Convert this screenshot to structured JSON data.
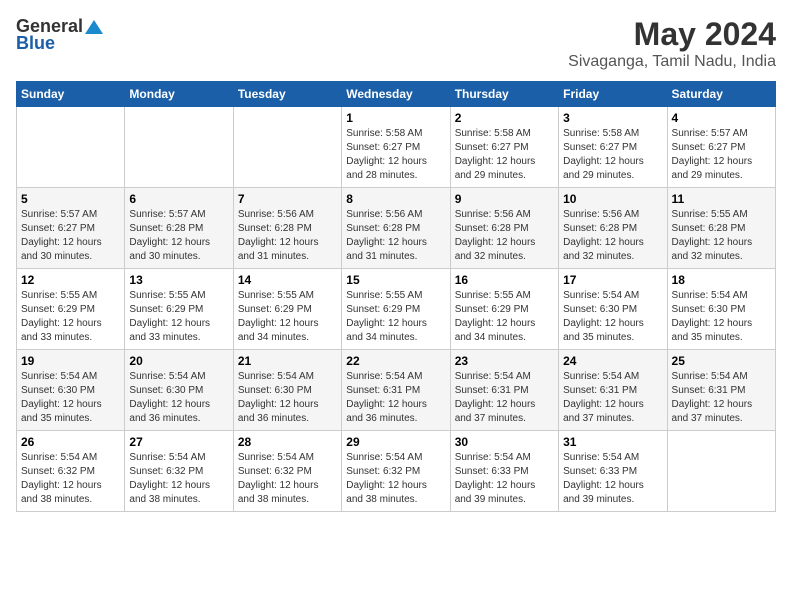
{
  "logo": {
    "general": "General",
    "blue": "Blue"
  },
  "title": {
    "month": "May 2024",
    "location": "Sivaganga, Tamil Nadu, India"
  },
  "headers": [
    "Sunday",
    "Monday",
    "Tuesday",
    "Wednesday",
    "Thursday",
    "Friday",
    "Saturday"
  ],
  "weeks": [
    [
      {
        "day": "",
        "info": ""
      },
      {
        "day": "",
        "info": ""
      },
      {
        "day": "",
        "info": ""
      },
      {
        "day": "1",
        "info": "Sunrise: 5:58 AM\nSunset: 6:27 PM\nDaylight: 12 hours\nand 28 minutes."
      },
      {
        "day": "2",
        "info": "Sunrise: 5:58 AM\nSunset: 6:27 PM\nDaylight: 12 hours\nand 29 minutes."
      },
      {
        "day": "3",
        "info": "Sunrise: 5:58 AM\nSunset: 6:27 PM\nDaylight: 12 hours\nand 29 minutes."
      },
      {
        "day": "4",
        "info": "Sunrise: 5:57 AM\nSunset: 6:27 PM\nDaylight: 12 hours\nand 29 minutes."
      }
    ],
    [
      {
        "day": "5",
        "info": "Sunrise: 5:57 AM\nSunset: 6:27 PM\nDaylight: 12 hours\nand 30 minutes."
      },
      {
        "day": "6",
        "info": "Sunrise: 5:57 AM\nSunset: 6:28 PM\nDaylight: 12 hours\nand 30 minutes."
      },
      {
        "day": "7",
        "info": "Sunrise: 5:56 AM\nSunset: 6:28 PM\nDaylight: 12 hours\nand 31 minutes."
      },
      {
        "day": "8",
        "info": "Sunrise: 5:56 AM\nSunset: 6:28 PM\nDaylight: 12 hours\nand 31 minutes."
      },
      {
        "day": "9",
        "info": "Sunrise: 5:56 AM\nSunset: 6:28 PM\nDaylight: 12 hours\nand 32 minutes."
      },
      {
        "day": "10",
        "info": "Sunrise: 5:56 AM\nSunset: 6:28 PM\nDaylight: 12 hours\nand 32 minutes."
      },
      {
        "day": "11",
        "info": "Sunrise: 5:55 AM\nSunset: 6:28 PM\nDaylight: 12 hours\nand 32 minutes."
      }
    ],
    [
      {
        "day": "12",
        "info": "Sunrise: 5:55 AM\nSunset: 6:29 PM\nDaylight: 12 hours\nand 33 minutes."
      },
      {
        "day": "13",
        "info": "Sunrise: 5:55 AM\nSunset: 6:29 PM\nDaylight: 12 hours\nand 33 minutes."
      },
      {
        "day": "14",
        "info": "Sunrise: 5:55 AM\nSunset: 6:29 PM\nDaylight: 12 hours\nand 34 minutes."
      },
      {
        "day": "15",
        "info": "Sunrise: 5:55 AM\nSunset: 6:29 PM\nDaylight: 12 hours\nand 34 minutes."
      },
      {
        "day": "16",
        "info": "Sunrise: 5:55 AM\nSunset: 6:29 PM\nDaylight: 12 hours\nand 34 minutes."
      },
      {
        "day": "17",
        "info": "Sunrise: 5:54 AM\nSunset: 6:30 PM\nDaylight: 12 hours\nand 35 minutes."
      },
      {
        "day": "18",
        "info": "Sunrise: 5:54 AM\nSunset: 6:30 PM\nDaylight: 12 hours\nand 35 minutes."
      }
    ],
    [
      {
        "day": "19",
        "info": "Sunrise: 5:54 AM\nSunset: 6:30 PM\nDaylight: 12 hours\nand 35 minutes."
      },
      {
        "day": "20",
        "info": "Sunrise: 5:54 AM\nSunset: 6:30 PM\nDaylight: 12 hours\nand 36 minutes."
      },
      {
        "day": "21",
        "info": "Sunrise: 5:54 AM\nSunset: 6:30 PM\nDaylight: 12 hours\nand 36 minutes."
      },
      {
        "day": "22",
        "info": "Sunrise: 5:54 AM\nSunset: 6:31 PM\nDaylight: 12 hours\nand 36 minutes."
      },
      {
        "day": "23",
        "info": "Sunrise: 5:54 AM\nSunset: 6:31 PM\nDaylight: 12 hours\nand 37 minutes."
      },
      {
        "day": "24",
        "info": "Sunrise: 5:54 AM\nSunset: 6:31 PM\nDaylight: 12 hours\nand 37 minutes."
      },
      {
        "day": "25",
        "info": "Sunrise: 5:54 AM\nSunset: 6:31 PM\nDaylight: 12 hours\nand 37 minutes."
      }
    ],
    [
      {
        "day": "26",
        "info": "Sunrise: 5:54 AM\nSunset: 6:32 PM\nDaylight: 12 hours\nand 38 minutes."
      },
      {
        "day": "27",
        "info": "Sunrise: 5:54 AM\nSunset: 6:32 PM\nDaylight: 12 hours\nand 38 minutes."
      },
      {
        "day": "28",
        "info": "Sunrise: 5:54 AM\nSunset: 6:32 PM\nDaylight: 12 hours\nand 38 minutes."
      },
      {
        "day": "29",
        "info": "Sunrise: 5:54 AM\nSunset: 6:32 PM\nDaylight: 12 hours\nand 38 minutes."
      },
      {
        "day": "30",
        "info": "Sunrise: 5:54 AM\nSunset: 6:33 PM\nDaylight: 12 hours\nand 39 minutes."
      },
      {
        "day": "31",
        "info": "Sunrise: 5:54 AM\nSunset: 6:33 PM\nDaylight: 12 hours\nand 39 minutes."
      },
      {
        "day": "",
        "info": ""
      }
    ]
  ]
}
